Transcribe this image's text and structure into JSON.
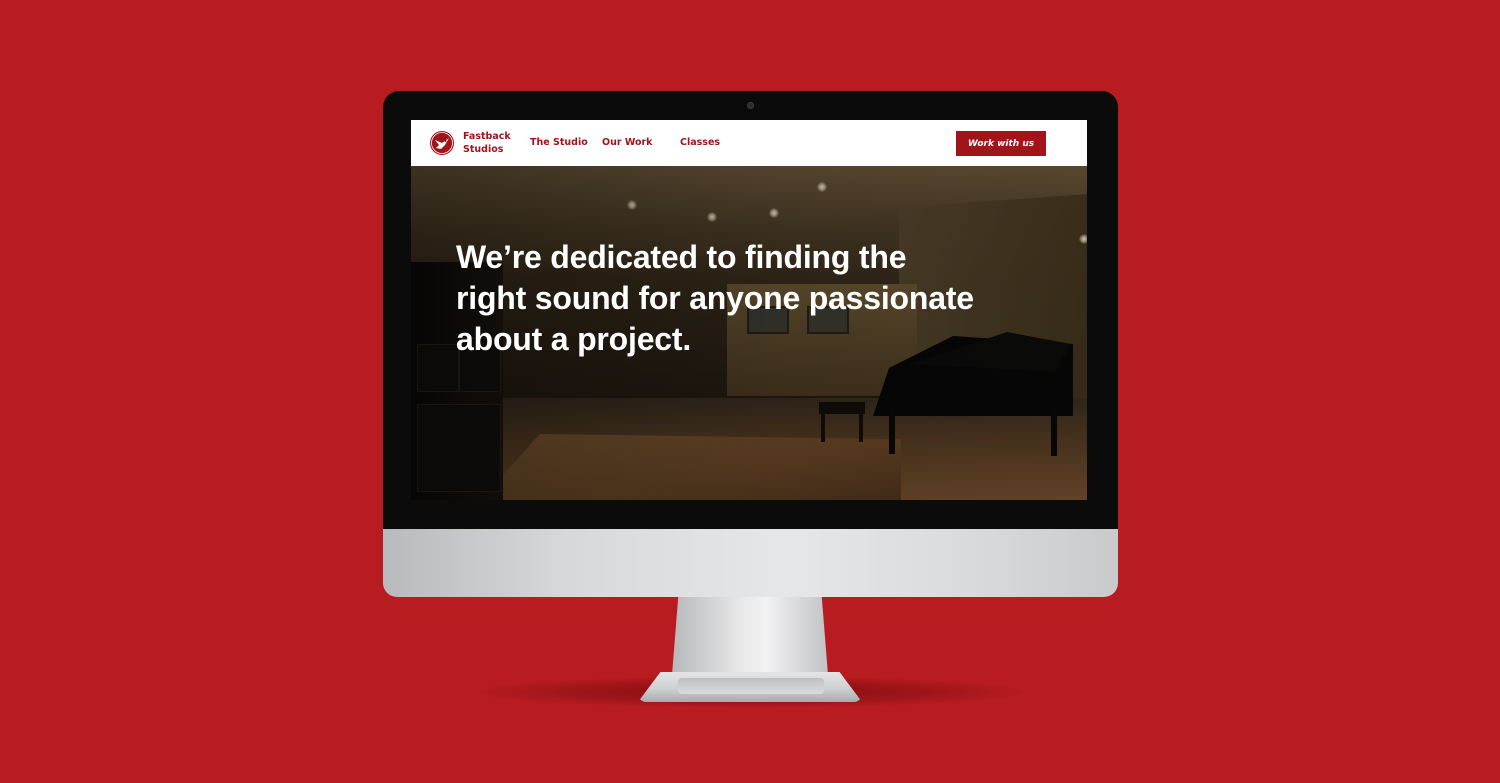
{
  "page": {
    "background_color": "#b81c21",
    "accent_color": "#a0141a"
  },
  "device": {
    "type": "desktop-monitor"
  },
  "site": {
    "brand": {
      "logo_icon": "bird-in-circle-logo",
      "name_line1": "Fastback",
      "name_line2": "Studios"
    },
    "nav": {
      "items": [
        {
          "label": "The Studio"
        },
        {
          "label": "Our Work"
        },
        {
          "label": "Classes"
        }
      ],
      "cta_label": "Work with us"
    },
    "hero": {
      "image_subject": "recording studio live room with grand piano",
      "headline_lines": [
        "We’re dedicated to finding the",
        "right sound for anyone passionate",
        "about a project."
      ]
    }
  }
}
